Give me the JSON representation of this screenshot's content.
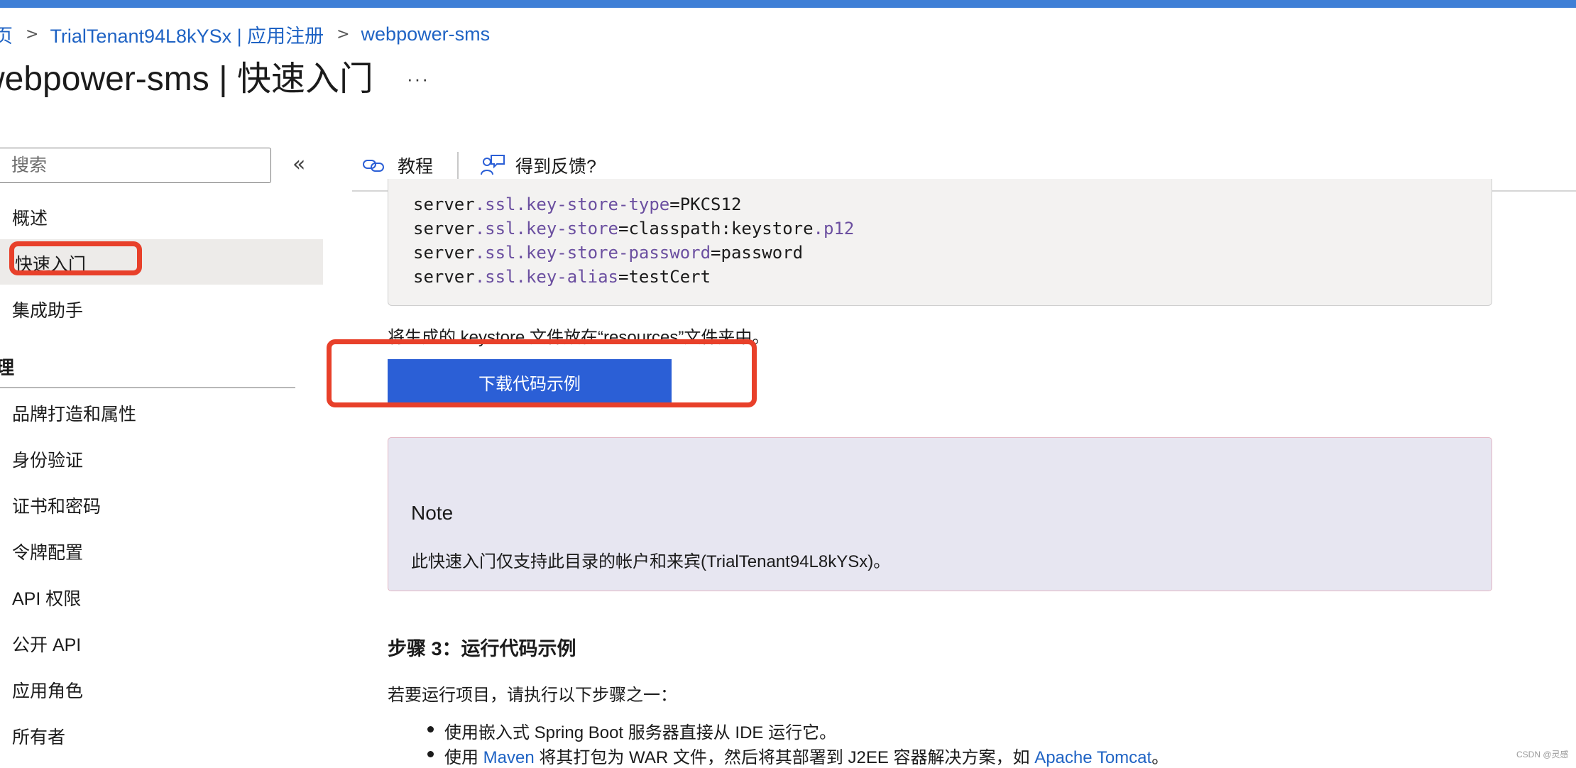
{
  "breadcrumb": {
    "home_partial": "页",
    "app_registrations": "TrialTenant94L8kYSx | 应用注册",
    "current": "webpower-sms",
    "separator": ">"
  },
  "title": {
    "text": "webpower-sms | 快速入门",
    "more": "···"
  },
  "sidebar": {
    "search_placeholder": "搜索",
    "collapse": "«",
    "items": [
      "概述",
      "快速入门",
      "集成助手"
    ],
    "section_partial": "理",
    "manage_items": [
      "品牌打造和属性",
      "身份验证",
      "证书和密码",
      "令牌配置",
      "API 权限",
      "公开 API",
      "应用角色",
      "所有者"
    ]
  },
  "command_bar": {
    "tutorial": "教程",
    "feedback": "得到反馈?"
  },
  "code": {
    "lines": [
      {
        "obj": "server",
        "prop": ".ssl.key-store-type",
        "eq": "=",
        "val": "PKCS12",
        "ext": ""
      },
      {
        "obj": "server",
        "prop": ".ssl.key-store",
        "eq": "=",
        "val": "classpath:keystore",
        "ext": ".p12"
      },
      {
        "obj": "server",
        "prop": ".ssl.key-store-password",
        "eq": "=",
        "val": "password",
        "ext": ""
      },
      {
        "obj": "server",
        "prop": ".ssl.key-alias",
        "eq": "=",
        "val": "testCert",
        "ext": ""
      }
    ]
  },
  "main": {
    "keystore_note": "将生成的 keystore 文件放在“resources”文件夹中。",
    "download_button": "下载代码示例",
    "note_title": "Note",
    "note_text": "此快速入门仅支持此目录的帐户和来宾(TrialTenant94L8kYSx)。",
    "step3_heading": "步骤 3：运行代码示例",
    "step3_intro": "若要运行项目，请执行以下步骤之一：",
    "bullet1": "使用嵌入式 Spring Boot 服务器直接从 IDE 运行它。",
    "bullet2_prefix": "使用 ",
    "bullet2_link1": "Maven",
    "bullet2_middle": " 将其打包为 WAR 文件，然后将其部署到 J2EE 容器解决方案，如 ",
    "bullet2_link2": "Apache Tomcat",
    "bullet2_suffix": "。"
  },
  "watermark": "CSDN @灵感",
  "colors": {
    "accent": "#2b5fd6",
    "link": "#1f63c4",
    "highlight": "#e8402a",
    "note_bg": "#e7e6f1"
  }
}
